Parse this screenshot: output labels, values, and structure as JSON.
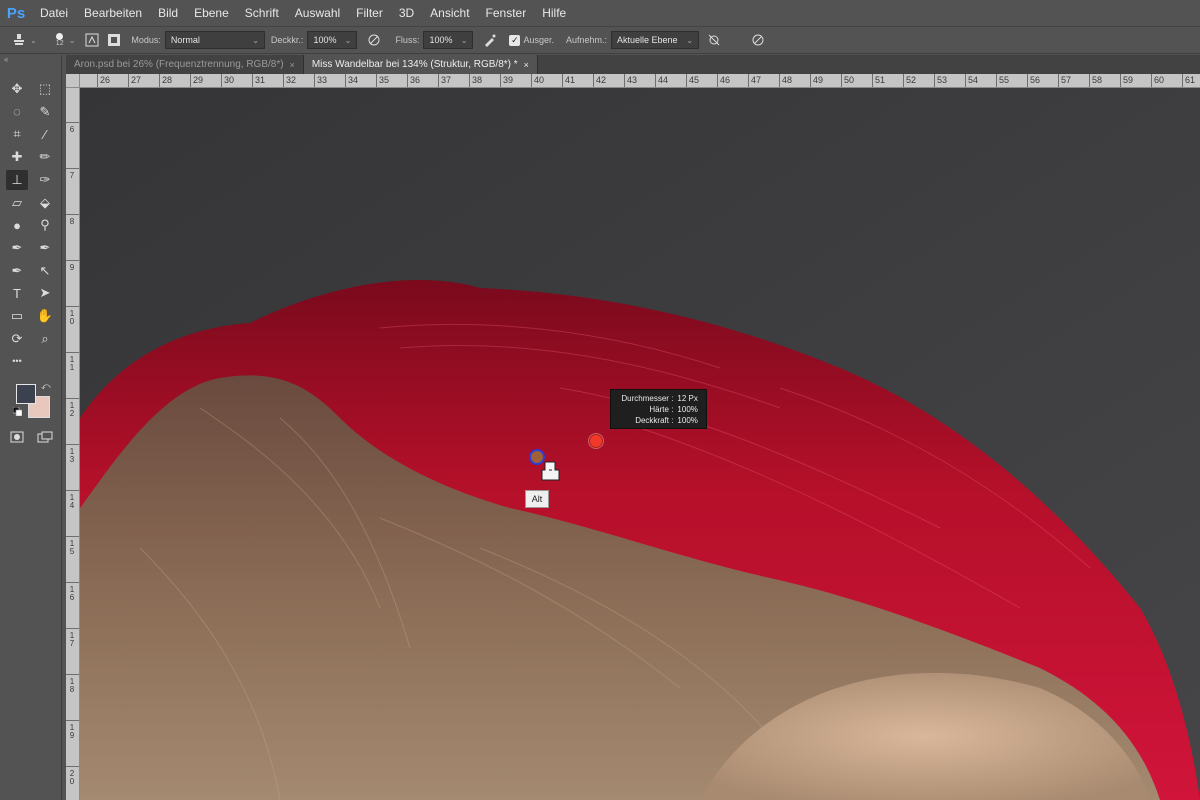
{
  "app": {
    "logo": "Ps"
  },
  "menu": [
    "Datei",
    "Bearbeiten",
    "Bild",
    "Ebene",
    "Schrift",
    "Auswahl",
    "Filter",
    "3D",
    "Ansicht",
    "Fenster",
    "Hilfe"
  ],
  "options": {
    "brush_size": "12",
    "modus_label": "Modus:",
    "modus_value": "Normal",
    "deckkr_label": "Deckkr.:",
    "deckkr_value": "100%",
    "fluss_label": "Fluss:",
    "fluss_value": "100%",
    "ausger_label": "Ausger.",
    "aufnehm_label": "Aufnehm.:",
    "aufnehm_value": "Aktuelle Ebene"
  },
  "tabs": [
    {
      "label": "Aron.psd bei 26% (Frequenztrennung, RGB/8*)",
      "active": false
    },
    {
      "label": "Miss Wandelbar bei 134% (Struktur, RGB/8*) *",
      "active": true
    }
  ],
  "tab_close": "×",
  "ruler_top": [
    "26",
    "27",
    "28",
    "29",
    "30",
    "31",
    "32",
    "33",
    "34",
    "35",
    "36",
    "37",
    "38",
    "39",
    "40",
    "41",
    "42",
    "43",
    "44",
    "45",
    "46",
    "47",
    "48",
    "49",
    "50",
    "51",
    "52",
    "53",
    "54",
    "55",
    "56",
    "57",
    "58",
    "59",
    "60",
    "61"
  ],
  "ruler_left": [
    "6",
    "7",
    "8",
    "9",
    "1 0",
    "1 1",
    "1 2",
    "1 3",
    "1 4",
    "1 5",
    "1 6",
    "1 7",
    "1 8",
    "1 9",
    "2 0"
  ],
  "hud": {
    "rows": [
      {
        "k": "Durchmesser :",
        "v": "12 Px"
      },
      {
        "k": "Härte :",
        "v": "100%"
      },
      {
        "k": "Deckkraft :",
        "v": "100%"
      }
    ]
  },
  "tooltip": {
    "alt": "Alt"
  },
  "colors": {
    "foreground": "#3c4150",
    "background": "#e8c7bc",
    "accent": "#4aa3ff",
    "hair_red": "#c8102e"
  },
  "icons": {
    "toolbar": [
      "move-icon",
      "marquee-icon",
      "lasso-icon",
      "quick-select-icon",
      "crop-icon",
      "eyedropper-icon",
      "healing-icon",
      "brush-icon",
      "clone-stamp-icon",
      "history-brush-icon",
      "eraser-icon",
      "paint-bucket-icon",
      "blur-icon",
      "dodge-icon",
      "pen-icon",
      "pen-alt-icon",
      "path-select-icon",
      "direct-select-icon",
      "type-icon",
      "path-arrow-icon",
      "rectangle-icon",
      "hand-icon",
      "rotate-view-icon",
      "zoom-icon",
      "more-icon"
    ]
  }
}
